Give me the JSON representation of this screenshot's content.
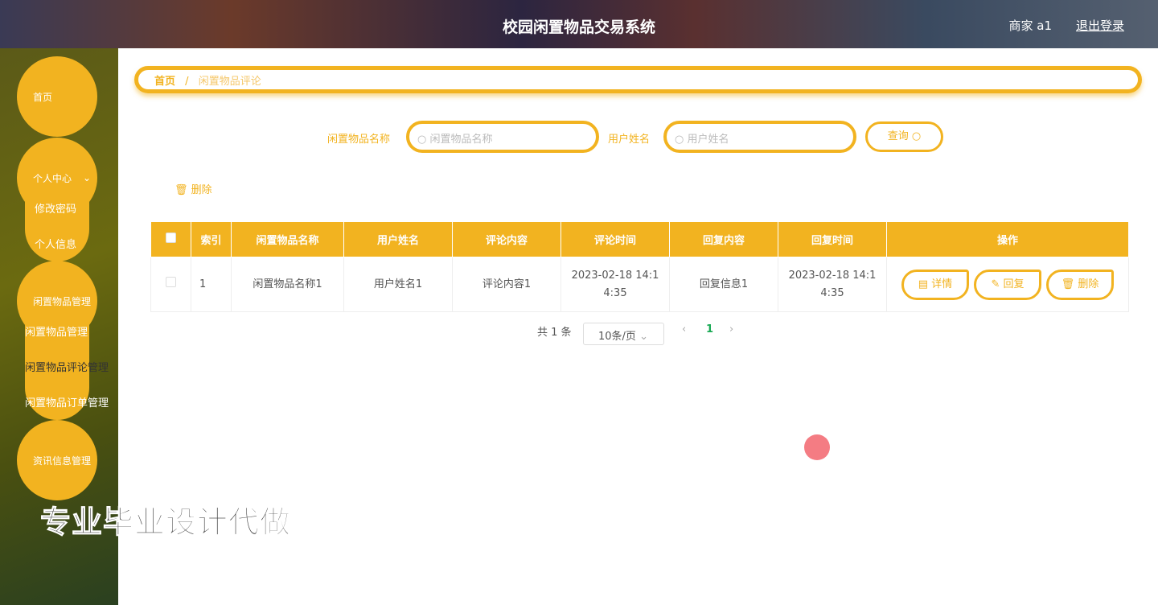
{
  "header": {
    "title": "校园闲置物品交易系统",
    "user": "商家 a1",
    "logout": "退出登录"
  },
  "sidebar": {
    "home": "首页",
    "personal": "个人中心",
    "change_password": "修改密码",
    "personal_info": "个人信息",
    "goods": "闲置物品管理",
    "goods_manage": "闲置物品管理",
    "goods_comment": "闲置物品评论管理",
    "goods_order": "闲置物品订单管理",
    "news": "资讯信息管理"
  },
  "breadcrumb": {
    "home": "首页",
    "sep": "/",
    "current": "闲置物品评论"
  },
  "search": {
    "name_label": "闲置物品名称",
    "name_placeholder": "闲置物品名称",
    "user_label": "用户姓名",
    "user_placeholder": "用户姓名",
    "query": "查询"
  },
  "toolbar": {
    "delete": "删除"
  },
  "table": {
    "headers": [
      "索引",
      "闲置物品名称",
      "用户姓名",
      "评论内容",
      "评论时间",
      "回复内容",
      "回复时间",
      "操作"
    ],
    "rows": [
      {
        "index": "1",
        "name": "闲置物品名称1",
        "user": "用户姓名1",
        "comment": "评论内容1",
        "comment_time": "2023-02-18 14:14:35",
        "reply": "回复信息1",
        "reply_time": "2023-02-18 14:14:35"
      }
    ],
    "actions": {
      "detail": "详情",
      "reply": "回复",
      "delete": "删除"
    }
  },
  "pagination": {
    "total": "共 1 条",
    "page_size": "10条/页",
    "prev": "‹",
    "current": "1",
    "next": "›"
  },
  "watermark": "专业毕业设计代做"
}
